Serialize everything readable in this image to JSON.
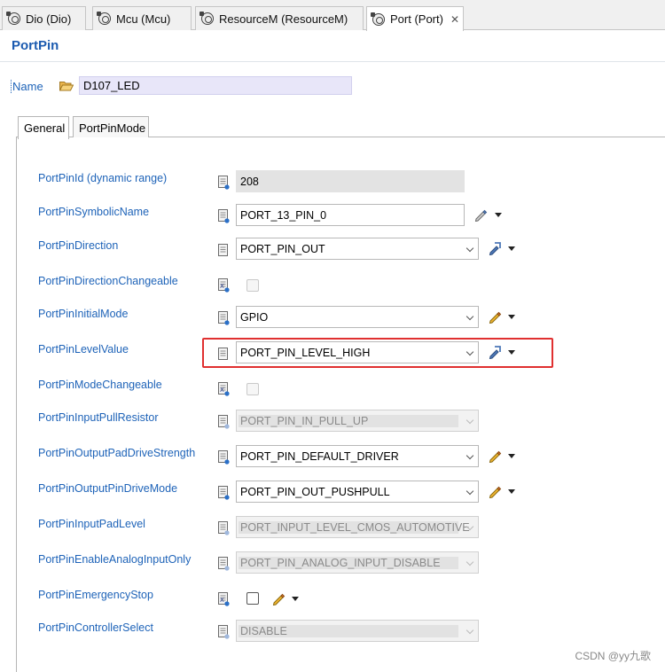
{
  "editor_tabs": [
    {
      "label": "Dio (Dio)",
      "active": false
    },
    {
      "label": "Mcu (Mcu)",
      "active": false
    },
    {
      "label": "ResourceM (ResourceM)",
      "active": false
    },
    {
      "label": "Port (Port)",
      "active": true
    }
  ],
  "page_title": "PortPin",
  "name": {
    "label": "Name",
    "value": "D107_LED"
  },
  "inner_tabs": [
    {
      "label": "General",
      "active": true
    },
    {
      "label": "PortPinMode",
      "active": false
    }
  ],
  "fields": [
    {
      "label": "PortPinId (dynamic range)",
      "value": "208"
    },
    {
      "label": "PortPinSymbolicName",
      "value": "PORT_13_PIN_0"
    },
    {
      "label": "PortPinDirection",
      "value": "PORT_PIN_OUT"
    },
    {
      "label": "PortPinDirectionChangeable",
      "value": ""
    },
    {
      "label": "PortPinInitialMode",
      "value": "GPIO"
    },
    {
      "label": "PortPinLevelValue",
      "value": "PORT_PIN_LEVEL_HIGH"
    },
    {
      "label": "PortPinModeChangeable",
      "value": ""
    },
    {
      "label": "PortPinInputPullResistor",
      "value": "PORT_PIN_IN_PULL_UP"
    },
    {
      "label": "PortPinOutputPadDriveStrength",
      "value": "PORT_PIN_DEFAULT_DRIVER"
    },
    {
      "label": "PortPinOutputPinDriveMode",
      "value": "PORT_PIN_OUT_PUSHPULL"
    },
    {
      "label": "PortPinInputPadLevel",
      "value": "PORT_INPUT_LEVEL_CMOS_AUTOMOTIVE"
    },
    {
      "label": "PortPinEnableAnalogInputOnly",
      "value": "PORT_PIN_ANALOG_INPUT_DISABLE"
    },
    {
      "label": "PortPinEmergencyStop",
      "value": ""
    },
    {
      "label": "PortPinControllerSelect",
      "value": "DISABLE"
    }
  ],
  "watermark": "CSDN @yy九歌",
  "colors": {
    "label_blue": "#1e63b8",
    "title_blue": "#1c5bb0",
    "highlight_red": "#e03030"
  }
}
